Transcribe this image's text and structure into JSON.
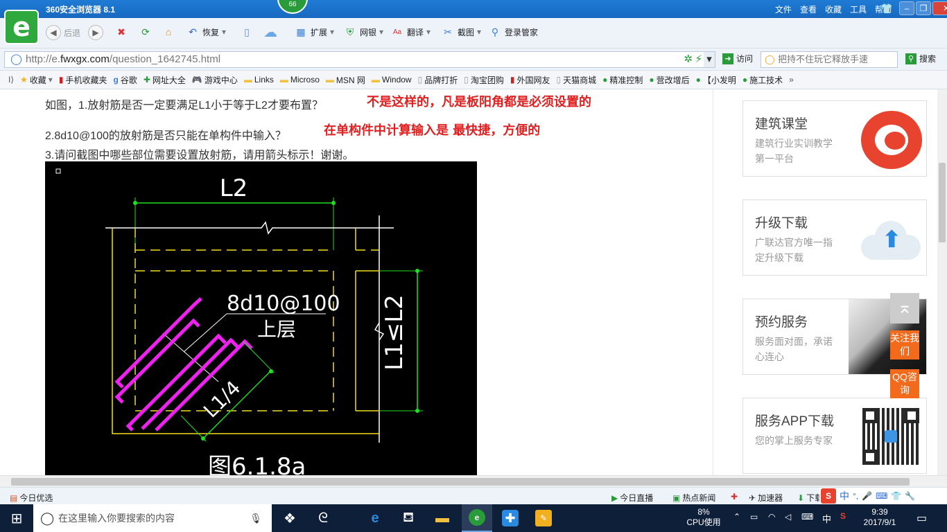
{
  "browser": {
    "title": "360安全浏览器 8.1",
    "badge": "66",
    "menu": [
      "文件",
      "查看",
      "收藏",
      "工具",
      "帮助"
    ],
    "back_label": "后退",
    "restore_label": "恢复",
    "extend_label": "扩展",
    "bank_label": "网银",
    "translate_label": "翻译",
    "screenshot_label": "截图",
    "login_label": "登录管家",
    "url_prefix": "http://e.",
    "url_domain": "fwxgx.com",
    "url_path": "/question_1642745.html",
    "go_label": "访问",
    "search_placeholder": "把持不住玩它释放手速",
    "search_label": "搜索"
  },
  "favbar": {
    "collect_label": "收藏",
    "items": [
      "手机收藏夹",
      "谷歌",
      "网址大全",
      "游戏中心",
      "Links",
      "Microso",
      "MSN 网",
      "Window",
      "品牌打折",
      "淘宝团购",
      "外国网友",
      "天猫商城",
      "精准控制",
      "营改增后",
      "【小发明",
      "施工技术"
    ]
  },
  "question": {
    "line1": "如图，1.放射筋是否一定要满足L1小于等于L2才要布置？",
    "answer1": "不是这样的，凡是板阳角都是必须设置的",
    "line2": "2.8d10@100的放射筋是否只能在单构件中输入？",
    "answer2": "在单构件中计算输入是 最快捷，方便的",
    "line3": "3.请问截图中哪些部位需要设置放射筋，请用箭头标示！谢谢。"
  },
  "cad": {
    "dim_top": "L2",
    "rebar": "8d10@100",
    "layer": "上层",
    "dim_right": "L1≤L2",
    "dim_diag": "L1/4",
    "caption": "图6.1.8a"
  },
  "sidebar": {
    "cards": [
      {
        "title": "建筑课堂",
        "sub": "建筑行业实训教学第一平台"
      },
      {
        "title": "升级下载",
        "sub": "广联达官方唯一指定升级下载"
      },
      {
        "title": "预约服务",
        "sub": "服务面对面，承诺心连心"
      },
      {
        "title": "服务APP下载",
        "sub": "您的掌上服务专家"
      }
    ],
    "follow": "关注我们",
    "qq": "QQ咨询"
  },
  "status": {
    "left": "今日优选",
    "live": "今日直播",
    "news": "热点新闻",
    "speed": "加速器",
    "download": "下载",
    "ime": "中"
  },
  "taskbar": {
    "search_placeholder": "在这里输入你要搜索的内容",
    "cpu_percent": "8%",
    "cpu_label": "CPU使用",
    "ime": "中",
    "time": "9:39",
    "date": "2017/9/1"
  }
}
